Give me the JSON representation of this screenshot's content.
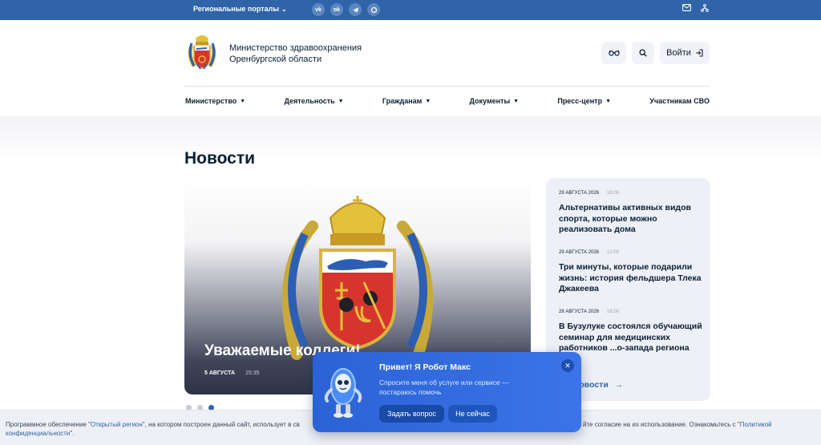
{
  "topbar": {
    "portals_label": "Региональные порталы",
    "social": [
      {
        "icon": "vk-icon",
        "glyph": "vk"
      },
      {
        "icon": "odnoklassniki-icon",
        "glyph": "ok"
      },
      {
        "icon": "telegram-icon",
        "glyph": "tg"
      },
      {
        "icon": "max-icon",
        "glyph": "m"
      }
    ],
    "right_icons": [
      "mail-icon",
      "sitemap-icon"
    ]
  },
  "header": {
    "org_name": "Министерство здравоохранения Оренбургской области",
    "login_label": "Войти"
  },
  "nav": {
    "items": [
      {
        "label": "Министерство",
        "dropdown": true
      },
      {
        "label": "Деятельность",
        "dropdown": true
      },
      {
        "label": "Гражданам",
        "dropdown": true
      },
      {
        "label": "Документы",
        "dropdown": true
      },
      {
        "label": "Пресс-центр",
        "dropdown": true
      },
      {
        "label": "Участникам СВО",
        "dropdown": false
      }
    ]
  },
  "main": {
    "title": "Новости",
    "slide": {
      "title": "Уважаемые коллеги!",
      "date": "5 АВГУСТА",
      "time": "15:35"
    },
    "news": [
      {
        "date": "29 АВГУСТА 2026",
        "time": "16:00",
        "title": "Альтернативы активных видов спорта, которые можно реализовать дома"
      },
      {
        "date": "29 АВГУСТА 2026",
        "time": "12:00",
        "title": "Три минуты, которые подарили жизнь: история фельдшера Тлека Джакеева"
      },
      {
        "date": "28 АВГУСТА 2026",
        "time": "16:00",
        "title": "В Бузулуке состоялся обучающий семинар для медицинских работников ...о-запада региона"
      }
    ],
    "all_news_label": "новости"
  },
  "cookie": {
    "line1_prefix": "Программное обеспечение \"",
    "open_region": "Открытый регион",
    "line1_suffix": "\", на котором построен данный сайт, использует в св",
    "line1_right": "йте согласие на их использование. Ознакомьтесь с \"",
    "privacy_1": "Политикой",
    "privacy_2": "конфиденциальности",
    "line2_suffix": "\"."
  },
  "bot": {
    "title": "Привет! Я Робот Макс",
    "text": "Спросите меня об услуге или сервисе — постараюсь помочь",
    "ask_label": "Задать вопрос",
    "later_label": "Не сейчас"
  },
  "colors": {
    "topbar": "#2f64a8",
    "accent": "#2f64a8",
    "text": "#0b1f35",
    "bot": "#2b63d6"
  }
}
